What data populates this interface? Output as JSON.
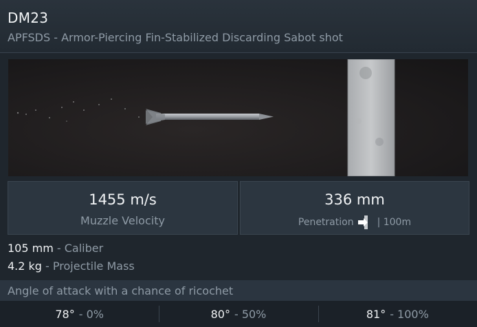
{
  "shell": {
    "name": "DM23",
    "type": "APFSDS - Armor-Piercing Fin-Stabilized Discarding Sabot shot"
  },
  "stats": {
    "velocity": {
      "value": "1455 m/s",
      "label": "Muzzle Velocity"
    },
    "penetration": {
      "value": "336 mm",
      "label": "Penetration",
      "range": "| 100m",
      "icon": "penetration-icon"
    }
  },
  "properties": [
    {
      "value": "105 mm",
      "label": "- Caliber"
    },
    {
      "value": "4.2 kg",
      "label": "- Projectile Mass"
    }
  ],
  "ricochet": {
    "title": "Angle of attack with a chance of ricochet",
    "entries": [
      {
        "angle": "78°",
        "chance": "- 0%"
      },
      {
        "angle": "80°",
        "chance": "- 50%"
      },
      {
        "angle": "81°",
        "chance": "- 100%"
      }
    ]
  }
}
